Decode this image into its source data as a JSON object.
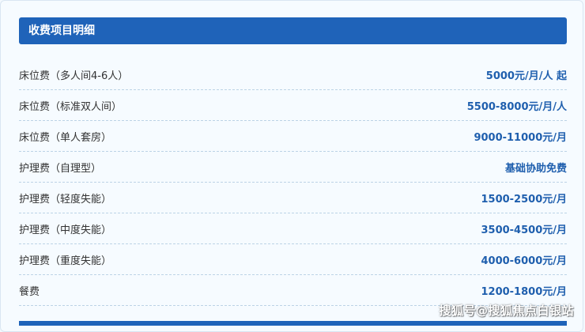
{
  "section": {
    "title": "收费项目明细"
  },
  "fees": [
    {
      "name": "床位费（多人间4-6人）",
      "price": "5000元/月/人 起"
    },
    {
      "name": "床位费（标准双人间）",
      "price": "5500-8000元/月/人"
    },
    {
      "name": "床位费（单人套房）",
      "price": "9000-11000元/月"
    },
    {
      "name": "护理费（自理型）",
      "price": "基础协助免费"
    },
    {
      "name": "护理费（轻度失能）",
      "price": "1500-2500元/月"
    },
    {
      "name": "护理费（中度失能）",
      "price": "3500-4500元/月"
    },
    {
      "name": "护理费（重度失能）",
      "price": "4000-6000元/月"
    },
    {
      "name": "餐费",
      "price": "1200-1800元/月"
    }
  ],
  "watermark": "搜狐号@搜狐焦点白银站",
  "colors": {
    "header_bg": "#1f63b9",
    "price_text": "#1f5fae",
    "page_bg": "#f4f9fe"
  }
}
